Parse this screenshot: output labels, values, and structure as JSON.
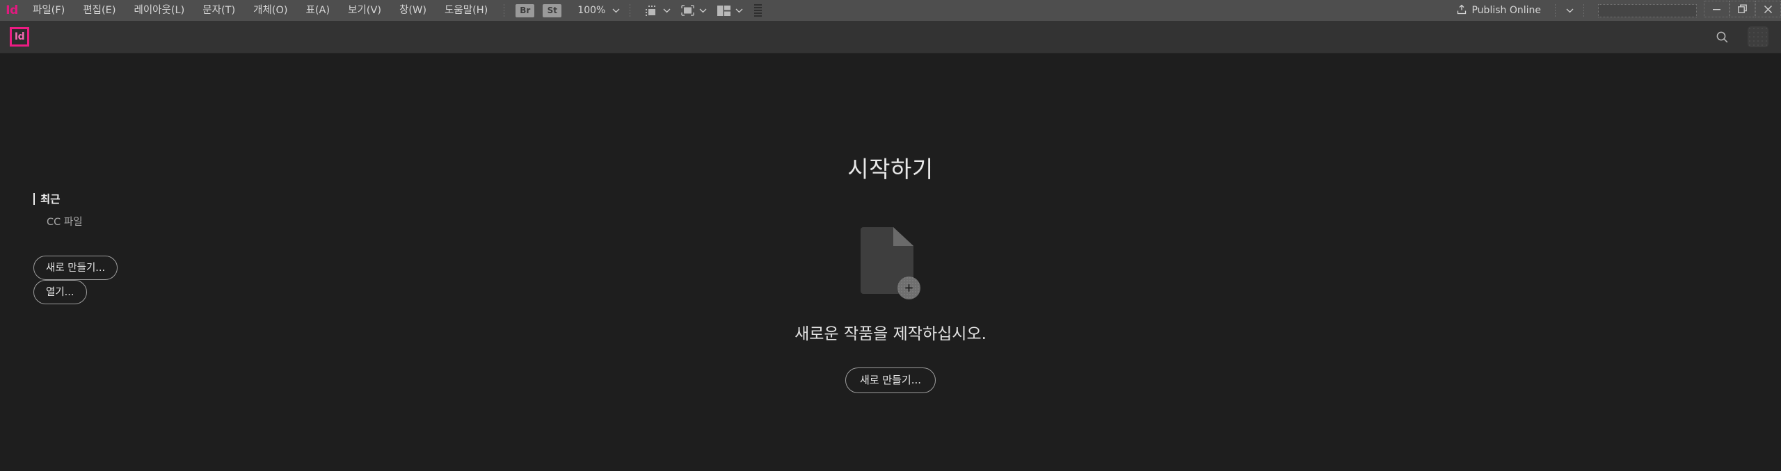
{
  "menubar": {
    "app_logo": "Id",
    "items": [
      {
        "label": "파일(F)",
        "name": "menu-file"
      },
      {
        "label": "편집(E)",
        "name": "menu-edit"
      },
      {
        "label": "레이아웃(L)",
        "name": "menu-layout"
      },
      {
        "label": "문자(T)",
        "name": "menu-type"
      },
      {
        "label": "개체(O)",
        "name": "menu-object"
      },
      {
        "label": "표(A)",
        "name": "menu-table"
      },
      {
        "label": "보기(V)",
        "name": "menu-view"
      },
      {
        "label": "창(W)",
        "name": "menu-window"
      },
      {
        "label": "도움말(H)",
        "name": "menu-help"
      }
    ],
    "bridge_label": "Br",
    "stock_label": "St",
    "zoom_level": "100%",
    "publish_label": "Publish Online",
    "publish_icon": "publish-upload-icon",
    "search_value": "",
    "search_placeholder": "",
    "window_controls": {
      "minimize": "—",
      "restore": "❐",
      "close": "✕"
    }
  },
  "appbar": {
    "logo_text": "Id",
    "search_icon": "search-icon",
    "avatar_icon": "avatar"
  },
  "main": {
    "hero_title": "시작하기",
    "sidebar": {
      "section_label": "최근",
      "items": [
        {
          "label": "CC 파일",
          "name": "sidebar-item-cc-files"
        }
      ],
      "buttons": [
        {
          "label": "새로 만들기...",
          "name": "sidebar-new-button"
        },
        {
          "label": "열기...",
          "name": "sidebar-open-button"
        }
      ]
    },
    "empty_state": {
      "icon": "new-document-icon",
      "message": "새로운 작품을 제작하십시오.",
      "cta_label": "새로 만들기..."
    }
  },
  "colors": {
    "menubar_bg": "#4e4e4e",
    "appbar_bg": "#333333",
    "canvas_bg": "#1e1e1e",
    "brand_magenta": "#ec1c83",
    "text_primary": "#e8e8e8",
    "text_muted": "#a7a7a7"
  }
}
